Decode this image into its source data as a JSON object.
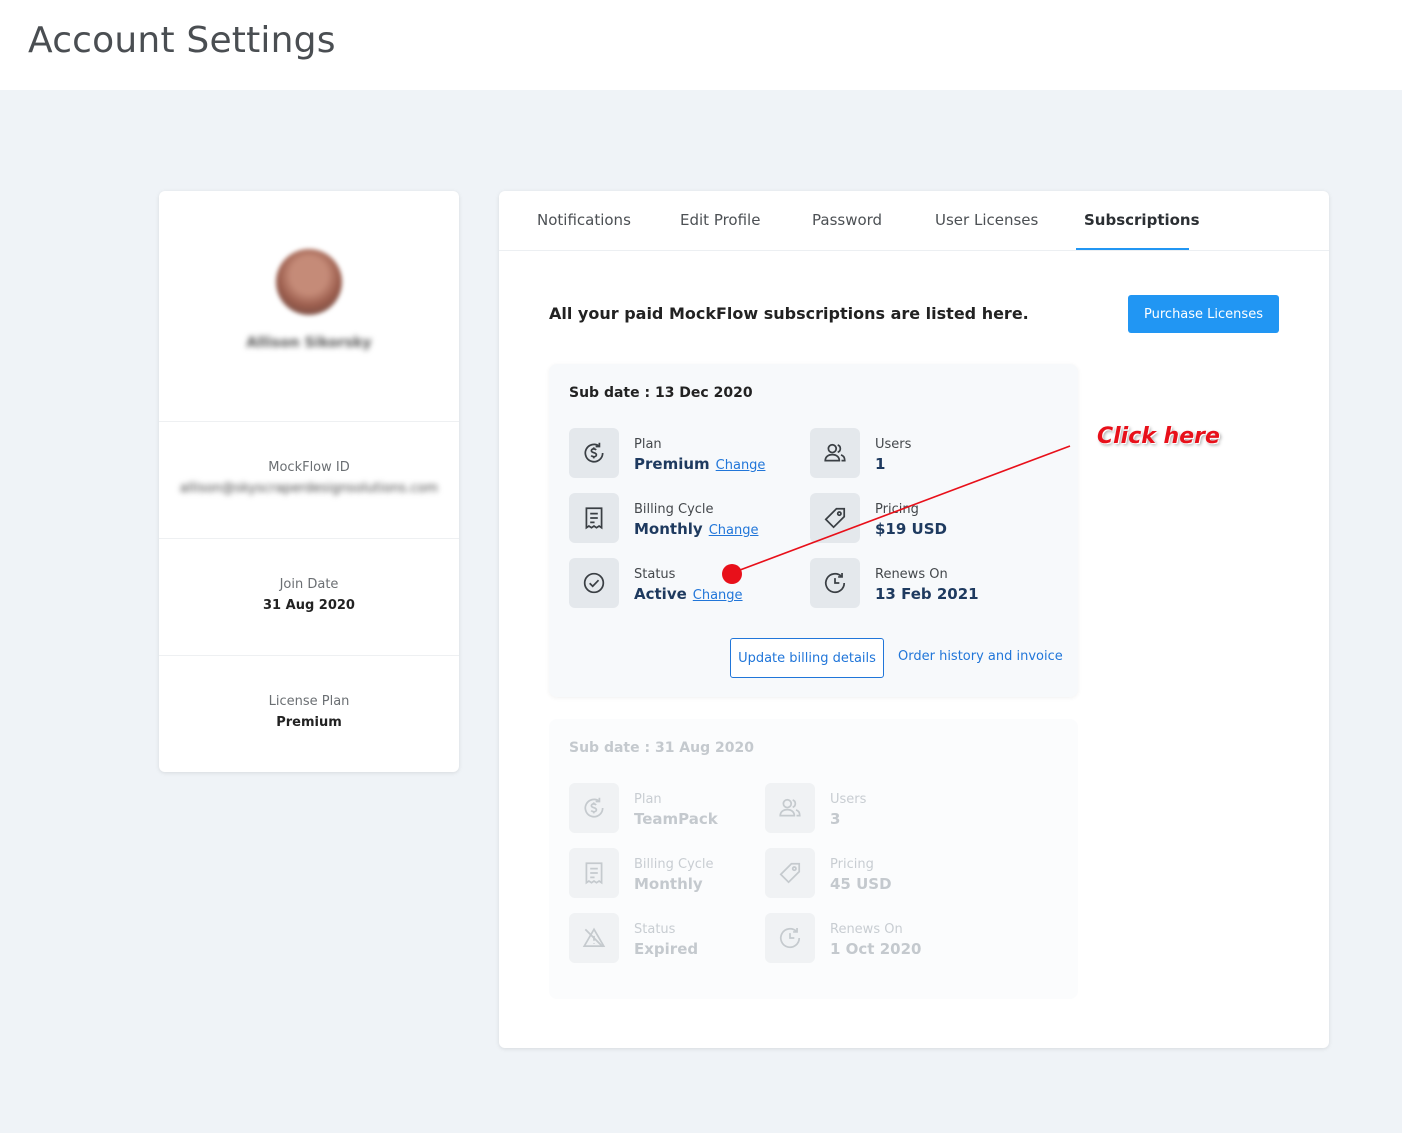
{
  "page": {
    "title": "Account Settings"
  },
  "profile": {
    "username": "Allison Sikorsky",
    "mockflow_id_label": "MockFlow ID",
    "mockflow_id_value": "allison@skyscraperdesignsolutions.com",
    "join_date_label": "Join Date",
    "join_date_value": "31 Aug 2020",
    "license_plan_label": "License Plan",
    "license_plan_value": "Premium"
  },
  "tabs": [
    {
      "label": "Notifications"
    },
    {
      "label": "Edit Profile"
    },
    {
      "label": "Password"
    },
    {
      "label": "User Licenses"
    },
    {
      "label": "Subscriptions",
      "active": true
    }
  ],
  "subscriptions": {
    "intro": "All your paid MockFlow subscriptions are listed here.",
    "purchase_button": "Purchase Licenses",
    "change_link": "Change",
    "update_billing_button": "Update billing details",
    "order_history_link": "Order history and invoice",
    "cards": [
      {
        "sub_date": "Sub date :  13 Dec 2020",
        "plan_label": "Plan",
        "plan_value": "Premium",
        "users_label": "Users",
        "users_value": "1",
        "billing_label": "Billing Cycle",
        "billing_value": "Monthly",
        "pricing_label": "Pricing",
        "pricing_value": "$19 USD",
        "status_label": "Status",
        "status_value": "Active",
        "renews_label": "Renews On",
        "renews_value": "13  Feb 2021"
      },
      {
        "sub_date": "Sub date :  31 Aug 2020",
        "plan_label": "Plan",
        "plan_value": "TeamPack",
        "users_label": "Users",
        "users_value": "3",
        "billing_label": "Billing Cycle",
        "billing_value": "Monthly",
        "pricing_label": "Pricing",
        "pricing_value": "45 USD",
        "status_label": "Status",
        "status_value": "Expired",
        "renews_label": "Renews On",
        "renews_value": "1  Oct 2020"
      }
    ]
  },
  "annotation": {
    "text": "Click here",
    "color": "#e8101a"
  },
  "colors": {
    "accent": "#2196f3",
    "link": "#2176d9",
    "background": "#eff3f7"
  },
  "icons": [
    "dollar-refresh-icon",
    "users-icon",
    "receipt-icon",
    "price-tag-icon",
    "check-circle-icon",
    "clock-renew-icon",
    "warning-expired-icon"
  ]
}
